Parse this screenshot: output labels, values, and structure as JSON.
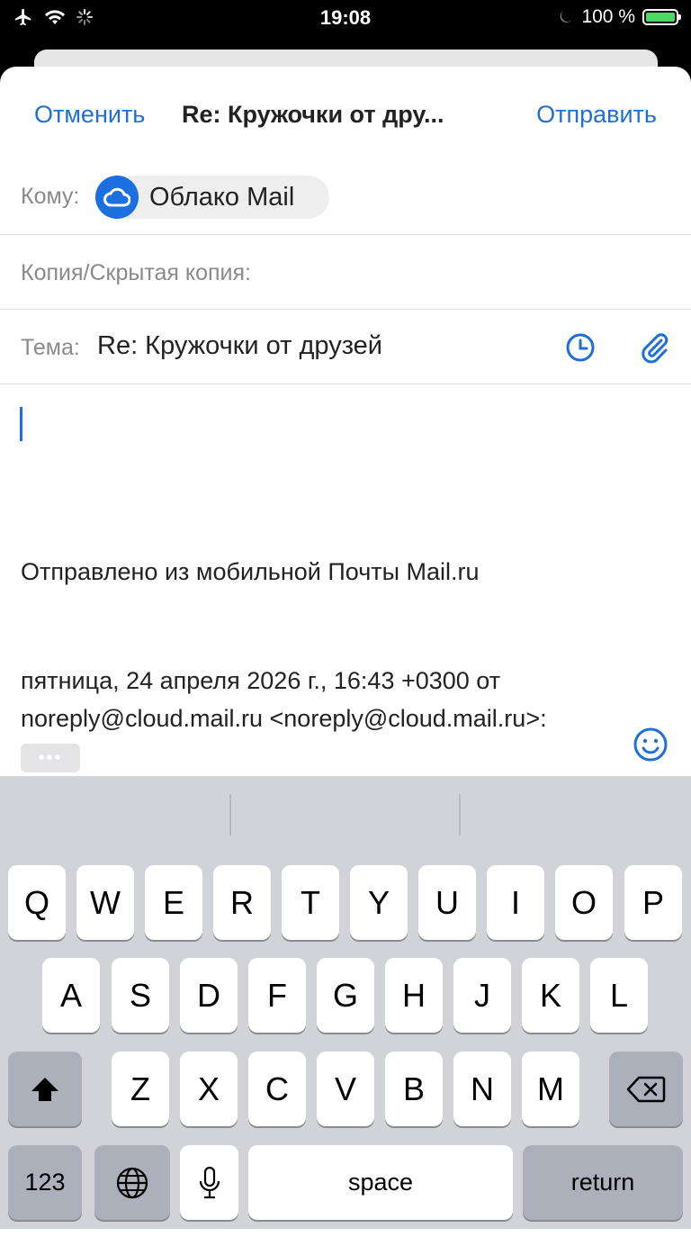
{
  "status_bar": {
    "time": "19:08",
    "battery_percent": "100 %",
    "icons": [
      "airplane-icon",
      "wifi-icon",
      "loading-icon",
      "moon-icon",
      "battery-charging-icon"
    ]
  },
  "nav": {
    "cancel": "Отменить",
    "title": "Re: Кружочки от дру...",
    "send": "Отправить"
  },
  "to": {
    "label": "Кому:",
    "recipient": "Облако Mail"
  },
  "cc": {
    "label": "Копия/Скрытая копия:"
  },
  "subject": {
    "label": "Тема:",
    "value": "Re: Кружочки от друзей"
  },
  "body": {
    "signature": "Отправлено из мобильной Почты Mail.ru",
    "quote_line1": "пятница, 24 апреля 2026 г., 16:43 +0300 от",
    "quote_line2": "noreply@cloud.mail.ru <noreply@cloud.mail.ru>:",
    "ellipsis": "•••"
  },
  "keyboard": {
    "row1": [
      "Q",
      "W",
      "E",
      "R",
      "T",
      "Y",
      "U",
      "I",
      "O",
      "P"
    ],
    "row2": [
      "A",
      "S",
      "D",
      "F",
      "G",
      "H",
      "J",
      "K",
      "L"
    ],
    "row3": [
      "Z",
      "X",
      "C",
      "V",
      "B",
      "N",
      "M"
    ],
    "numbers": "123",
    "space": "space",
    "return": "return"
  },
  "colors": {
    "accent": "#1e6fd9",
    "keyboard_bg": "#d1d3d9"
  }
}
